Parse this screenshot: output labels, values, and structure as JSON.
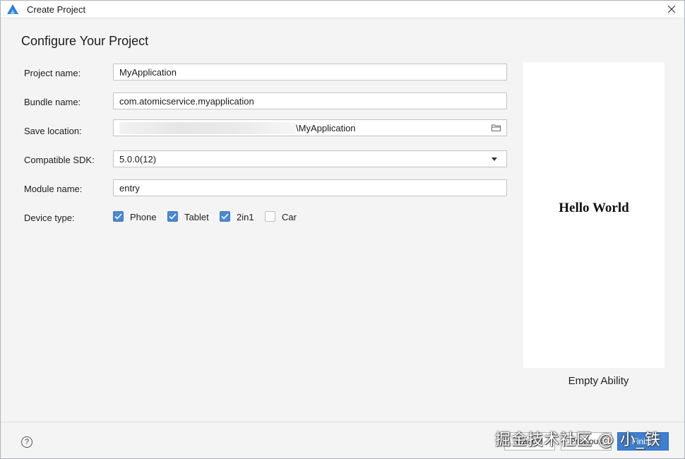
{
  "window": {
    "title": "Create Project",
    "app_icon": "deveco-logo-icon",
    "close_icon": "close-icon"
  },
  "heading": "Configure Your Project",
  "form": {
    "project_name": {
      "label": "Project name:",
      "value": "MyApplication"
    },
    "bundle_name": {
      "label": "Bundle name:",
      "value": "com.atomicservice.myapplication"
    },
    "save_location": {
      "label": "Save location:",
      "value_tail": "\\MyApplication",
      "browse_icon": "folder-icon"
    },
    "compatible_sdk": {
      "label": "Compatible SDK:",
      "value": "5.0.0(12)"
    },
    "module_name": {
      "label": "Module name:",
      "value": "entry"
    },
    "device_type": {
      "label": "Device type:",
      "options": [
        {
          "label": "Phone",
          "checked": true
        },
        {
          "label": "Tablet",
          "checked": true
        },
        {
          "label": "2in1",
          "checked": true
        },
        {
          "label": "Car",
          "checked": false
        }
      ]
    }
  },
  "preview": {
    "text": "Hello World",
    "template_name": "Empty Ability"
  },
  "footer": {
    "help_label": "?",
    "cancel_label": "Cancel",
    "previous_label": "Previous",
    "finish_label": "Finish"
  },
  "watermark": "掘金技术社区 @ 小_铁",
  "colors": {
    "accent": "#3d7fd1",
    "checkbox": "#4a88d0",
    "background": "#f4f4f4"
  }
}
